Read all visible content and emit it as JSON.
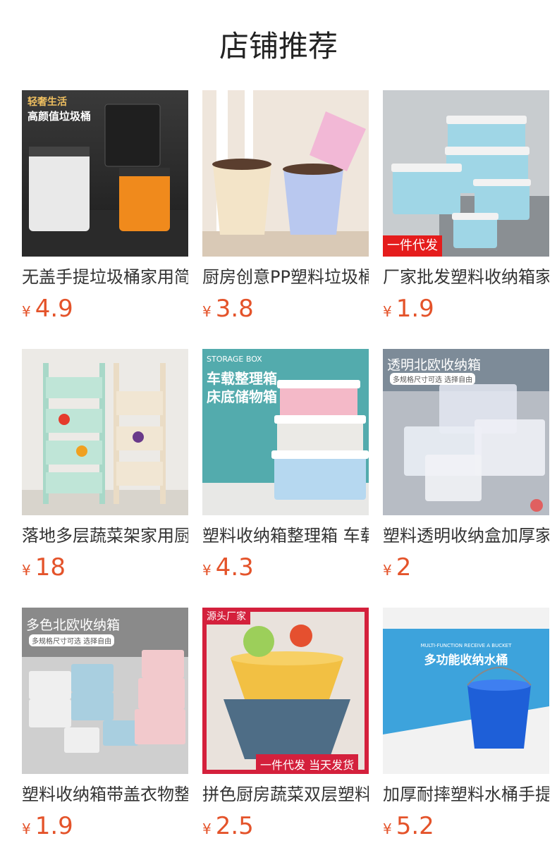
{
  "header": {
    "title": "店铺推荐"
  },
  "currency": "¥",
  "products": [
    {
      "name": "无盖手提垃圾桶家用简约",
      "price": "4.9",
      "img_text": [
        "轻奢生活",
        "高颜值垃圾桶"
      ]
    },
    {
      "name": "厨房创意PP塑料垃圾桶",
      "price": "3.8",
      "img_text": []
    },
    {
      "name": "厂家批发塑料收纳箱家用",
      "price": "1.9",
      "img_text": [
        "一件代发"
      ]
    },
    {
      "name": "落地多层蔬菜架家用厨房",
      "price": "18",
      "img_text": []
    },
    {
      "name": "塑料收纳箱整理箱 车载",
      "price": "4.3",
      "img_text": [
        "STORAGE BOX",
        "车载整理箱",
        "床底储物箱"
      ]
    },
    {
      "name": "塑料透明收纳盒加厚家用",
      "price": "2",
      "img_text": [
        "透明北欧收纳箱",
        "多规格尺寸可选 选择自由"
      ]
    },
    {
      "name": "塑料收纳箱带盖衣物整理",
      "price": "1.9",
      "img_text": [
        "多色北欧收纳箱",
        "多规格尺寸可选 选择自由"
      ]
    },
    {
      "name": "拼色厨房蔬菜双层塑料沥水",
      "price": "2.5",
      "img_text": [
        "源头厂家",
        "一件代发 当天发货"
      ]
    },
    {
      "name": "加厚耐摔塑料水桶手提家用",
      "price": "5.2",
      "img_text": [
        "MULTI-FUNCTION RECEIVE A BUCKET",
        "多功能收纳水桶"
      ]
    }
  ]
}
